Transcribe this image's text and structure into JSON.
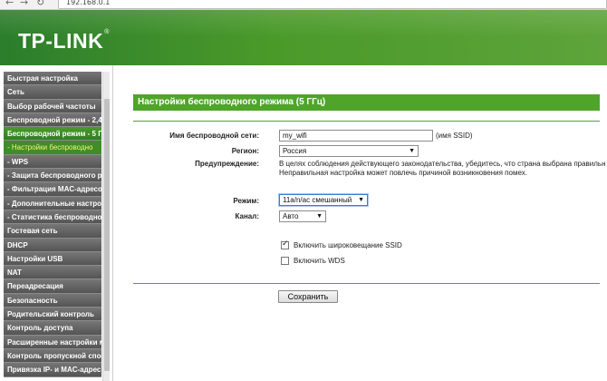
{
  "browser": {
    "url": "192.168.0.1",
    "back_icon": "arrow-left",
    "forward_icon": "arrow-right",
    "reload_icon": "reload"
  },
  "header": {
    "logo": "TP-LINK",
    "logo_mark": "®"
  },
  "sidebar": {
    "items": [
      {
        "label": "Быстрая настройка",
        "type": "main",
        "active": false
      },
      {
        "label": "Сеть",
        "type": "main",
        "active": false
      },
      {
        "label": "Выбор рабочей частоты",
        "type": "main",
        "active": false
      },
      {
        "label": "Беспроводной режим - 2,4",
        "type": "main",
        "active": false
      },
      {
        "label": "Беспроводной режим - 5 ГГ",
        "type": "main",
        "active": true
      },
      {
        "label": "- Настройки беспроводно",
        "type": "sub",
        "active": true
      },
      {
        "label": "- WPS",
        "type": "sub",
        "active": false
      },
      {
        "label": "- Защита беспроводного ре",
        "type": "sub",
        "active": false
      },
      {
        "label": "- Фильтрация MAC-адресо",
        "type": "sub",
        "active": false
      },
      {
        "label": "- Дополнительные настро",
        "type": "sub",
        "active": false
      },
      {
        "label": "- Статистика беспроводно",
        "type": "sub",
        "active": false
      },
      {
        "label": "Гостевая сеть",
        "type": "main",
        "active": false
      },
      {
        "label": "DHCP",
        "type": "main",
        "active": false
      },
      {
        "label": "Настройки USB",
        "type": "main",
        "active": false
      },
      {
        "label": "NAT",
        "type": "main",
        "active": false
      },
      {
        "label": "Переадресация",
        "type": "main",
        "active": false
      },
      {
        "label": "Безопасность",
        "type": "main",
        "active": false
      },
      {
        "label": "Родительский контроль",
        "type": "main",
        "active": false
      },
      {
        "label": "Контроль доступа",
        "type": "main",
        "active": false
      },
      {
        "label": "Расширенные настройки м",
        "type": "main",
        "active": false
      },
      {
        "label": "Контроль пропускной спосо",
        "type": "main",
        "active": false
      },
      {
        "label": "Привязка IP- и MAC-адрес",
        "type": "main",
        "active": false
      }
    ]
  },
  "main": {
    "title": "Настройки беспроводного режима (5 ГГц)",
    "ssid_label": "Имя беспроводной сети:",
    "ssid_value": "my_wifi",
    "ssid_hint": "(имя SSID)",
    "region_label": "Регион:",
    "region_value": "Россия",
    "warning_label": "Предупреждение:",
    "warning_line1": "В целях соблюдения действующего законодательства, убедитесь, что страна выбрана правильн",
    "warning_line2": "Неправильная настройка может повлечь причиной возникновения помех.",
    "mode_label": "Режим:",
    "mode_value": "11a/n/ac смешанный",
    "channel_label": "Канал:",
    "channel_value": "Авто",
    "ssid_broadcast_label": "Включить широковещание SSID",
    "ssid_broadcast_checked": true,
    "wds_label": "Включить WDS",
    "wds_checked": false,
    "save_label": "Сохранить"
  }
}
